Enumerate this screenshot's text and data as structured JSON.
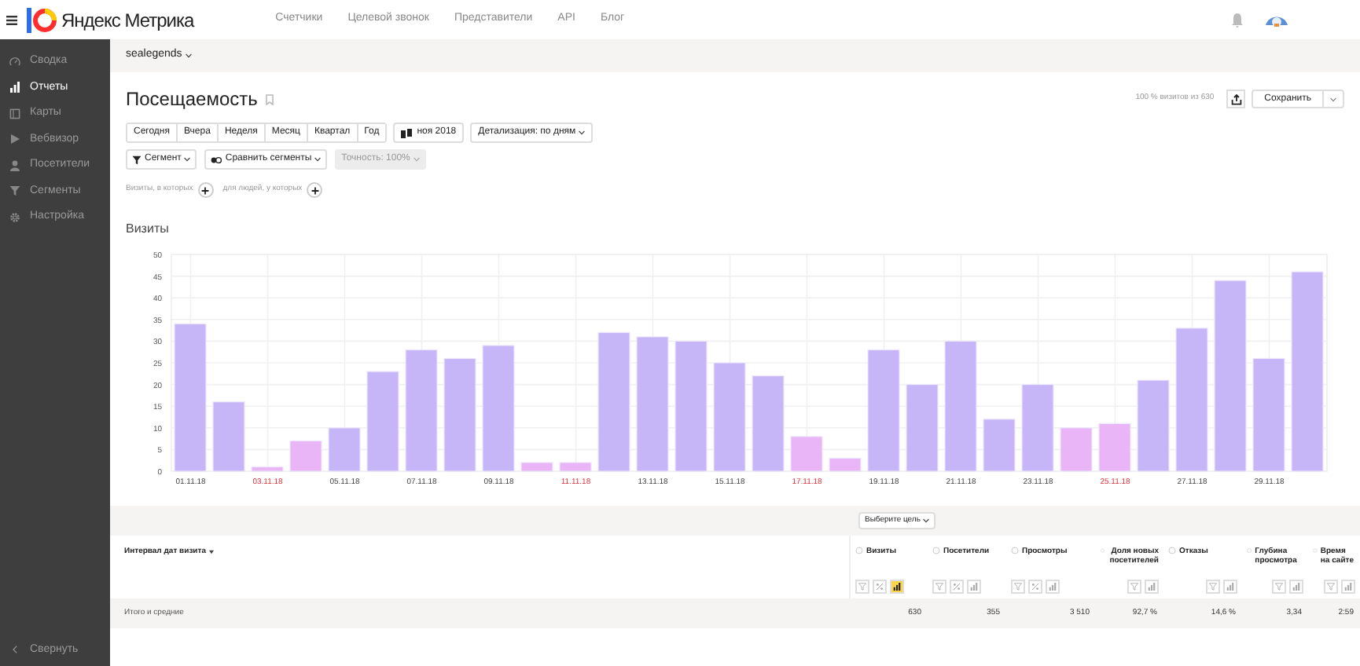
{
  "header": {
    "logo": "Яндекс Метрика",
    "nav": [
      "Счетчики",
      "Целевой звонок",
      "Представители",
      "API",
      "Блог"
    ]
  },
  "sidebar": {
    "items": [
      {
        "label": "Сводка",
        "selected": false
      },
      {
        "label": "Отчеты",
        "selected": true
      },
      {
        "label": "Карты",
        "selected": false
      },
      {
        "label": "Вебвизор",
        "selected": false
      },
      {
        "label": "Посетители",
        "selected": false
      },
      {
        "label": "Сегменты",
        "selected": false
      },
      {
        "label": "Настройка",
        "selected": false
      }
    ],
    "collapse": "Свернуть"
  },
  "account": "sealegends",
  "report": {
    "title": "Посещаемость",
    "sample": "100 % визитов из 630",
    "save": "Сохранить",
    "periods": [
      {
        "label": "Сегодня",
        "selected": false
      },
      {
        "label": "Вчера",
        "selected": false
      },
      {
        "label": "Неделя",
        "selected": false
      },
      {
        "label": "Месяц",
        "selected": false
      },
      {
        "label": "Квартал",
        "selected": false
      },
      {
        "label": "Год",
        "selected": false
      }
    ],
    "date": "ноя 2018",
    "detail": "Детализация: по дням",
    "segment": "Сегмент",
    "compare": "Сравнить сегменты",
    "accuracy": "Точность: 100%",
    "filters": [
      "Визиты, в которых",
      "для людей, у которых"
    ]
  },
  "chart": {
    "title": "Визиты",
    "chart_data": {
      "type": "bar",
      "grid": true,
      "categories": [
        "01.11.18",
        null,
        "03.11.18",
        null,
        "05.11.18",
        null,
        "07.11.18",
        null,
        "09.11.18",
        null,
        "11.11.18",
        null,
        "13.11.18",
        null,
        "15.11.18",
        null,
        "17.11.18",
        null,
        "19.11.18",
        null,
        "21.11.18",
        null,
        "23.11.18",
        null,
        "25.11.18",
        null,
        "27.11.18",
        null,
        "29.11.18",
        null
      ],
      "series": [
        {
          "color": "#c6b5f7",
          "values": [
            34,
            16,
            null,
            null,
            10,
            23,
            28,
            26,
            29,
            null,
            null,
            32,
            31,
            30,
            25,
            22,
            null,
            null,
            28,
            20,
            30,
            12,
            20,
            null,
            null,
            21,
            33,
            44,
            26,
            46
          ]
        },
        {
          "color": "#e9b5f7",
          "values": [
            null,
            null,
            1,
            7,
            null,
            null,
            null,
            null,
            null,
            2,
            2,
            null,
            null,
            null,
            null,
            null,
            8,
            3,
            null,
            null,
            null,
            null,
            null,
            10,
            11,
            null,
            null,
            null,
            null,
            null
          ]
        }
      ],
      "ylim": [
        0,
        50
      ],
      "yticks": [
        0,
        5,
        10,
        15,
        20,
        25,
        30,
        35,
        40,
        45,
        50
      ]
    }
  },
  "table": {
    "goal": "Выберите цель",
    "dimension": "Интервал дат визита",
    "columns": [
      {
        "label": "Визиты",
        "percent": true,
        "chart_selected": true
      },
      {
        "label": "Посетители",
        "percent": true,
        "chart_selected": false
      },
      {
        "label": "Просмотры",
        "percent": true,
        "chart_selected": false
      },
      {
        "label": "Доля новых посетителей",
        "percent": false,
        "chart_selected": false
      },
      {
        "label": "Отказы",
        "percent": false,
        "chart_selected": false
      },
      {
        "label": "Глубина просмотра",
        "percent": false,
        "chart_selected": false
      },
      {
        "label": "Время на сайте",
        "percent": false,
        "chart_selected": false
      }
    ],
    "totals": {
      "label": "Итого и средние",
      "values": [
        "630",
        "355",
        "3 510",
        "92,7 %",
        "14,6 %",
        "3,34",
        "2:59"
      ]
    }
  }
}
